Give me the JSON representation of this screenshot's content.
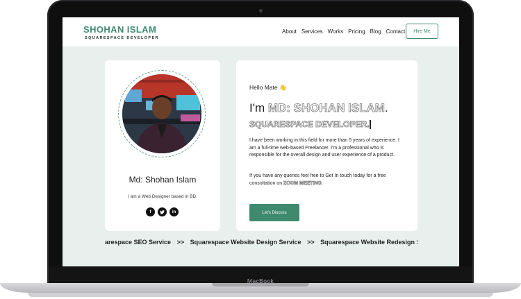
{
  "device": {
    "brand": "MacBook"
  },
  "nav": {
    "logo_title": "SHOHAN ISLAM",
    "logo_subtitle": "SQUARESPACE DEVELOPER",
    "menu": [
      "About",
      "Services",
      "Works",
      "Pricing",
      "Blog",
      "Contact"
    ],
    "hire_label": "Hire Me"
  },
  "profile": {
    "name": "Md: Shohan Islam",
    "tagline": "I am a Web Designer based in BD.",
    "socials": [
      "facebook-icon",
      "twitter-icon",
      "linkedin-icon"
    ]
  },
  "intro": {
    "greeting": "Hello Mate 👋",
    "im": "I'm ",
    "name_outline": "MD: SHOHAN ISLAM",
    "period": ".",
    "role": "SQUARESPACE DEVELOPER.",
    "paragraph1": "I have been working in this field for more than 5 years of experience. I am a full-time web-based Freelancer. I'm a professional who is responsible for the overall design and user experience of a product.",
    "paragraph2_pre": "If you have any queries feel free to Get In touch today for a free consultation on ",
    "paragraph2_highlight": "ZOOM MEETING",
    "paragraph2_post": ".",
    "cta_label": "Let's Discuss"
  },
  "services_ticker": [
    "arespace SEO Service",
    ">>",
    "Squarespace Website Design Service",
    ">>",
    "Squarespace Website Redesign Serv"
  ],
  "colors": {
    "accent": "#3f8a6f",
    "screen_bg": "#e8efec"
  }
}
